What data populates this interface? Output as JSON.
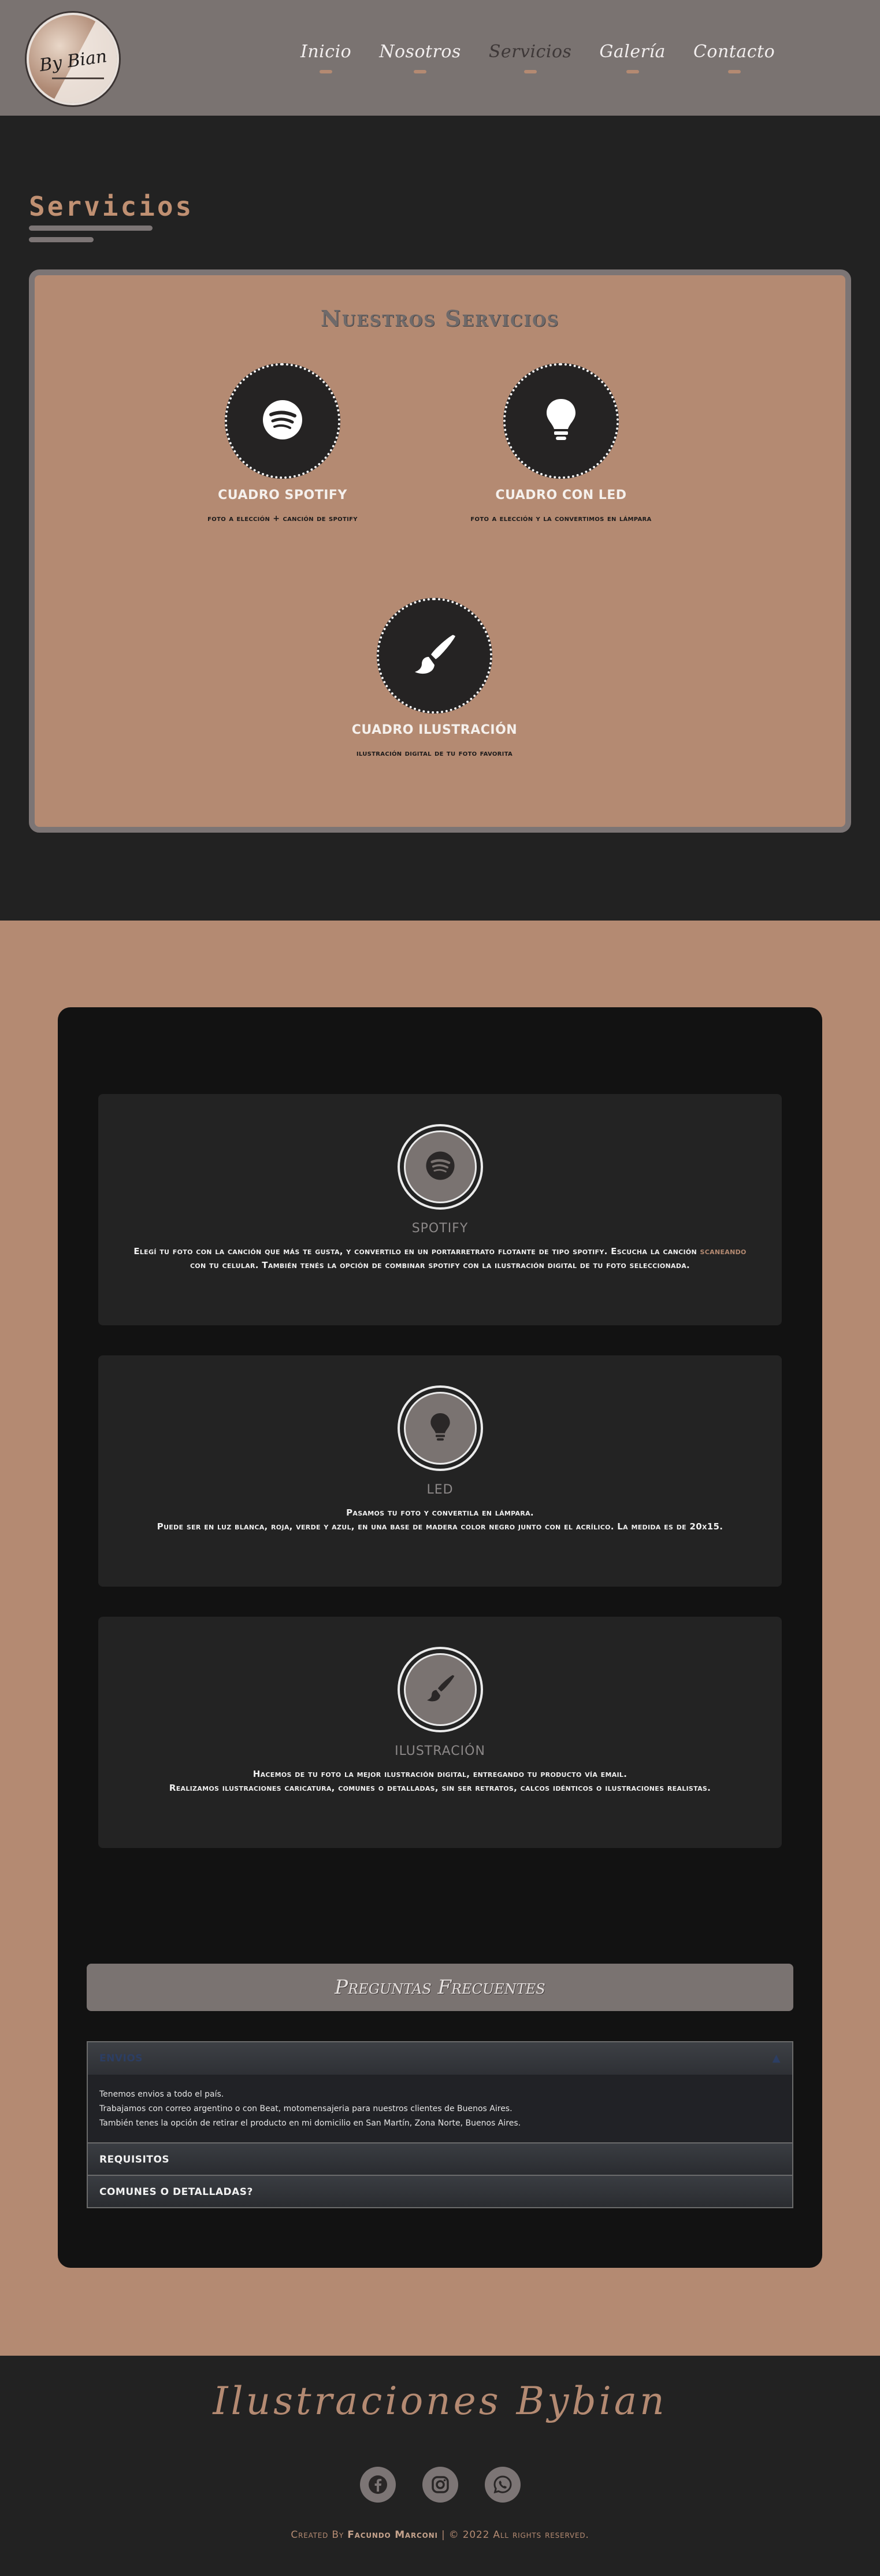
{
  "brand": {
    "logo_text": "By Bian"
  },
  "nav": {
    "items": [
      {
        "label": "Inicio"
      },
      {
        "label": "Nosotros"
      },
      {
        "label": "Servicios"
      },
      {
        "label": "Galería"
      },
      {
        "label": "Contacto"
      }
    ],
    "active": "Servicios"
  },
  "section": {
    "title": "Servicios"
  },
  "services_panel": {
    "heading": "Nuestros Servicios",
    "items": [
      {
        "title": "CUADRO SPOTIFY",
        "desc": "foto a elección + canción de spotify",
        "icon": "spotify-icon"
      },
      {
        "title": "CUADRO CON LED",
        "desc": "foto a elección y la convertimos en lámpara",
        "icon": "lightbulb-icon"
      },
      {
        "title": "CUADRO ILUSTRACIÓN",
        "desc": "ilustración digital de tu foto favorita",
        "icon": "paintbrush-icon"
      }
    ]
  },
  "details": [
    {
      "title": "SPOTIFY",
      "text_before": "Elegí tu foto con la canción que más te gusta, y convertilo en un portarretrato flotante de tipo spotify. Escucha la canción ",
      "highlight": "scaneando",
      "text_after": " con tu celular. También tenés la opción de combinar spotify con la ilustración digital de tu foto seleccionada.",
      "icon": "spotify-icon"
    },
    {
      "title": "LED",
      "line1": "Pasamos tu foto y convertila en lámpara.",
      "line2": "Puede ser en luz blanca, roja, verde y azul, en una base de madera color negro junto con el acrílico. La medida es de 20x15.",
      "icon": "lightbulb-icon"
    },
    {
      "title": "ILUSTRACIÓN",
      "line1": "Hacemos de tu foto la mejor ilustración digital, entregando tu producto vía email.",
      "line2": "Realizamos ilustraciones caricatura, comunes o detalladas, sin ser retratos, calcos idénticos o ilustraciones realistas.",
      "icon": "paintbrush-icon"
    }
  ],
  "faq": {
    "heading": "Preguntas Frecuentes",
    "items": [
      {
        "label": "ENVIOS",
        "open": true,
        "lines": [
          "Tenemos envios a todo el país.",
          "Trabajamos con correo argentino o con Beat, motomensajeria para nuestros clientes de Buenos Aires.",
          "También tenes la opción de retirar el producto en mi domicilio en San Martín, Zona Norte, Buenos Aires."
        ]
      },
      {
        "label": "REQUISITOS",
        "open": false
      },
      {
        "label": "COMUNES O DETALLADAS?",
        "open": false
      }
    ]
  },
  "footer": {
    "title": "Ilustraciones Bybian",
    "socials": [
      "facebook-icon",
      "instagram-icon",
      "whatsapp-icon"
    ],
    "credit_prefix": "Created By ",
    "credit_name": "Facundo Marconi",
    "credit_suffix": " | © 2022 All rights reserved."
  },
  "colors": {
    "accent": "#b48a72",
    "header": "#7a7371",
    "dark": "#222222",
    "card": "#121212"
  }
}
